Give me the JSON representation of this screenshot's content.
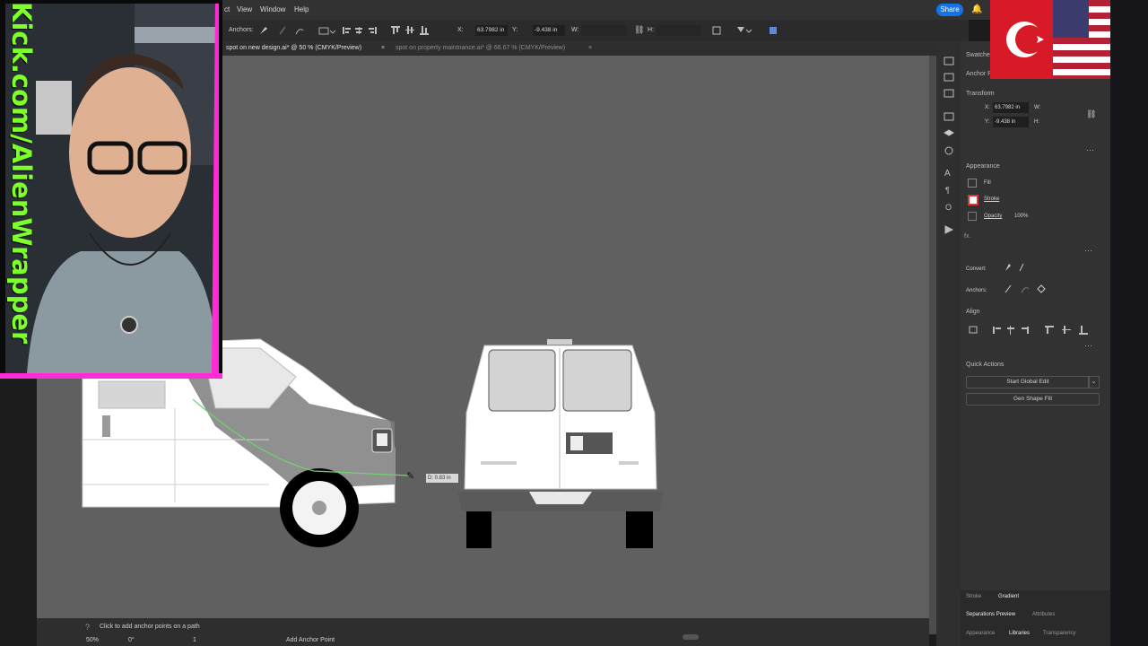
{
  "menu": {
    "items": [
      "ct",
      "View",
      "Window",
      "Help"
    ],
    "share_label": "Share"
  },
  "control_bar": {
    "anchors_label": "Anchors:",
    "x_label": "X:",
    "x_value": "63.7982 in",
    "y_label": "Y:",
    "y_value": "-9.438 in",
    "w_label": "W:",
    "h_label": "H:"
  },
  "tabs": [
    {
      "label": "spot on new design.ai* @ 50 % (CMYK/Preview)"
    },
    {
      "label": "spot on property maintnance.ai* @ 66.67 % (CMYK/Preview)"
    }
  ],
  "canvas": {
    "measure_tooltip": "D: 0.83 in"
  },
  "status": {
    "hint": "Click to add anchor points on a path",
    "zoom": "50%",
    "rotation": "0°",
    "artboard": "1",
    "tool_name": "Add Anchor Point"
  },
  "panel": {
    "header_swatches": "Swatches",
    "header_anchor": "Anchor P",
    "transform_title": "Transform",
    "x_label": "X:",
    "x_value": "63.7982 in",
    "y_label": "Y:",
    "y_value": "-9.438 in",
    "w_label": "W:",
    "h_label": "H:",
    "appearance_title": "Appearance",
    "fill_label": "Fill",
    "stroke_label": "Stroke",
    "opacity_label": "Opacity",
    "opacity_value": "100%",
    "fx_label": "fx.",
    "convert_label": "Convert:",
    "anchors_label": "Anchors:",
    "align_title": "Align",
    "quick_actions_title": "Quick Actions",
    "start_global_edit": "Start Global Edit",
    "gen_shape_fill": "Gen Shape Fill",
    "bottom_tabs_row1": [
      "Stroke",
      "Gradient"
    ],
    "bottom_tabs_row2": [
      "Separations Preview",
      "Attributes"
    ],
    "bottom_tabs_row3": [
      "Appearance",
      "Libraries",
      "Transparency"
    ]
  },
  "overlay": {
    "webcam_text": "Kick.com/AlienWrapper"
  },
  "colors": {
    "accent": "#1473e6",
    "canvas": "#606060",
    "panel": "#323232",
    "overlay_green": "#7cff2a",
    "overlay_pink": "#ff2bd6",
    "path_green": "#6fd36f"
  }
}
